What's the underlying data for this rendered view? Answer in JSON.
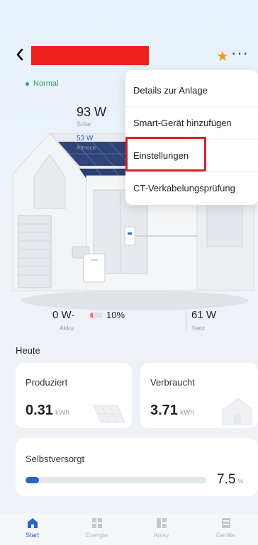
{
  "header": {
    "back_icon": "chevron-left-icon",
    "favorite_icon": "star-icon",
    "more_icon": "more-horizontal-icon",
    "accent": "#f39a1b",
    "redaction_color": "#ef1f1f"
  },
  "status": {
    "label": "Normal",
    "color": "#2e9f68"
  },
  "flow": {
    "solar": {
      "value": "93 W",
      "label": "Solar"
    },
    "atmoce": {
      "value": "53 W",
      "label": "Atmoce"
    },
    "akku": {
      "value": "0 W",
      "separator": "·",
      "percent": "10%",
      "label": "Akku",
      "level": 0.1
    },
    "netz": {
      "value": "61 W",
      "label": "Netz"
    }
  },
  "today": {
    "title": "Heute",
    "produced": {
      "label": "Produziert",
      "value": "0.31",
      "unit": "kWh"
    },
    "consumed": {
      "label": "Verbraucht",
      "value": "3.71",
      "unit": "kWh"
    },
    "self_supply": {
      "label": "Selbstversorgt",
      "value": "7.5",
      "unit": "%",
      "level": 0.075,
      "bar_color": "#2a63c7"
    }
  },
  "menu": {
    "items": [
      {
        "label": "Details zur Anlage"
      },
      {
        "label": "Smart-Gerät hinzufügen"
      },
      {
        "label": "Einstellungen",
        "highlighted": true
      },
      {
        "label": "CT-Verkabelungsprüfung"
      }
    ],
    "highlight_color": "#d5222a"
  },
  "nav": {
    "items": [
      {
        "label": "Start",
        "icon": "home-icon",
        "active": true
      },
      {
        "label": "Energie",
        "icon": "solar-panel-icon"
      },
      {
        "label": "Array",
        "icon": "array-grid-icon"
      },
      {
        "label": "Geräte",
        "icon": "device-icon"
      }
    ]
  }
}
